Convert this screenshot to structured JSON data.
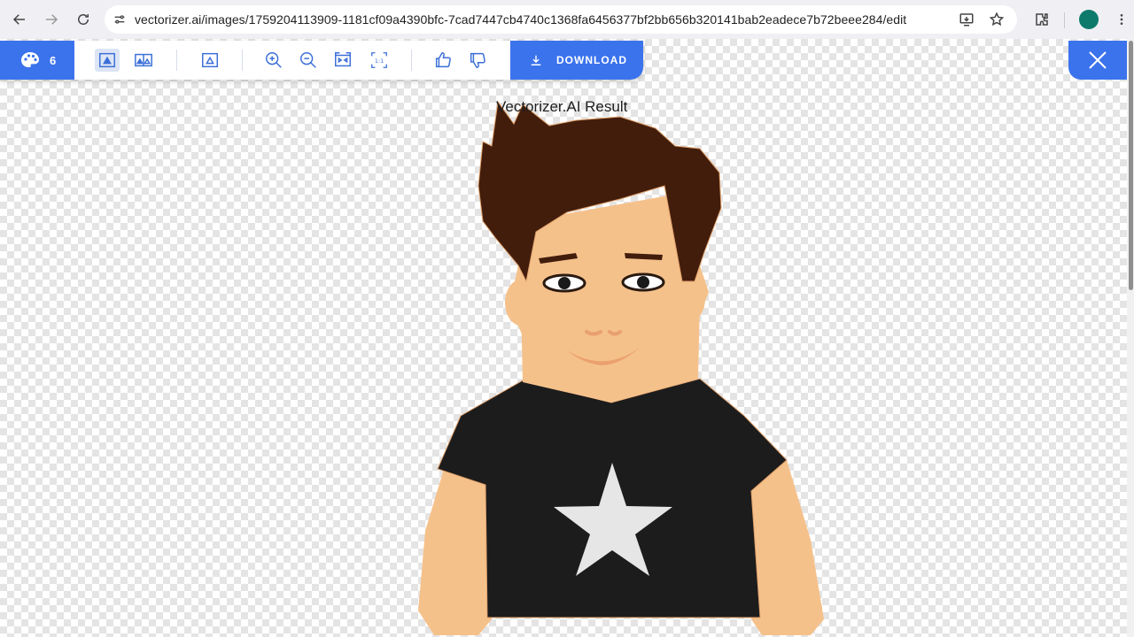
{
  "browser": {
    "url": "vectorizer.ai/images/1759204113909-1181cf09a4390bfc-7cad7447cb4740c1368fa6456377bf2bb656b320141bab2eadece7b72beee284/edit",
    "icons": [
      "back-icon",
      "forward-icon",
      "reload-icon",
      "site-info-icon",
      "install-app-icon",
      "bookmark-star-icon",
      "extensions-icon",
      "profile-avatar",
      "menu-icon"
    ]
  },
  "toolbar": {
    "palette_count": "6",
    "download_label": "DOWNLOAD",
    "icons": [
      "palette-icon",
      "single-view-icon",
      "side-by-side-view-icon",
      "overlay-view-icon",
      "zoom-in-icon",
      "zoom-out-icon",
      "fit-to-screen-icon",
      "actual-size-icon",
      "thumbs-up-icon",
      "thumbs-down-icon",
      "download-icon",
      "close-icon"
    ]
  },
  "result": {
    "title": "Vectorizer.AI Result"
  },
  "colors": {
    "accent": "#3b73ec",
    "hair": "#421d0c",
    "skin": "#f5c18b",
    "shirt": "#1c1c1c",
    "star": "#e6e6e6",
    "mouth": "#eba06e"
  }
}
